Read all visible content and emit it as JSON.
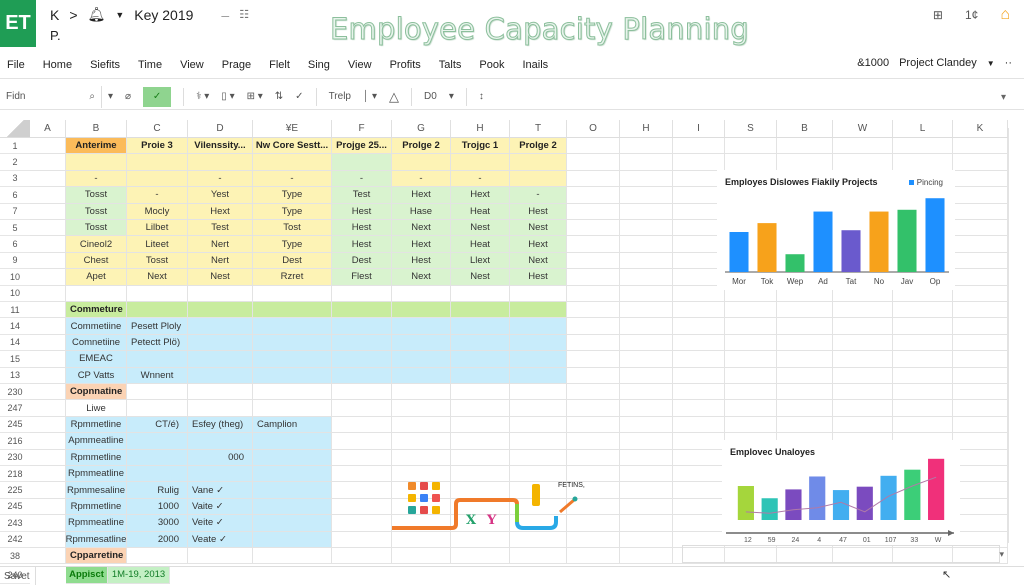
{
  "app": {
    "logo": "ET",
    "breadcrumb": [
      "K",
      ">",
      "Key 2019"
    ],
    "breadcrumb_sub": "P.",
    "doc_title": "Employee Capacity Planning",
    "top_right_icons": [
      "share-icon",
      "counter-icon",
      "home-icon"
    ],
    "top_right_counter": "1¢"
  },
  "menu": {
    "items": [
      "File",
      "Home",
      "Siefits",
      "Time",
      "View",
      "Prage",
      "Flelt",
      "Sing",
      "View",
      "Profits",
      "Talts",
      "Pook",
      "Inails"
    ],
    "user_count": "&1000",
    "project": "Project Clandey",
    "more": "··"
  },
  "toolbar": {
    "namebox": "Fidn",
    "font_name": "Trelp",
    "font_size": "D0"
  },
  "sheet": {
    "columns": [
      "A",
      "B",
      "C",
      "D",
      "¥E",
      "F",
      "G",
      "H",
      "T",
      "O",
      "H",
      "I",
      "S",
      "B",
      "W",
      "L",
      "K"
    ],
    "rows": [
      {
        "n": "1",
        "cells": [
          "",
          "Anterime",
          "Proie 3",
          "Vilenssity...",
          "Nw Core Sestt...",
          "Projge 25...",
          "Prolge 2",
          "Trojgc 1",
          "Prolge 2"
        ]
      },
      {
        "n": "2",
        "cells": [
          "",
          "",
          "",
          "",
          "",
          "",
          "",
          "",
          ""
        ]
      },
      {
        "n": "3",
        "cells": [
          "",
          "-",
          "",
          "-",
          "-",
          "-",
          "-",
          "-",
          ""
        ]
      },
      {
        "n": "6",
        "cells": [
          "",
          "Tosst",
          "-",
          "Yest",
          "Type",
          "Test",
          "Hext",
          "Hext",
          "-"
        ]
      },
      {
        "n": "7",
        "cells": [
          "",
          "Tosst",
          "Mocly",
          "Hext",
          "Type",
          "Hest",
          "Hase",
          "Heat",
          "Hest"
        ]
      },
      {
        "n": "5",
        "cells": [
          "",
          "Tosst",
          "Lilbet",
          "Test",
          "Tost",
          "Hest",
          "Next",
          "Nest",
          "Nest"
        ]
      },
      {
        "n": "6",
        "cells": [
          "",
          "Cineol2",
          "Liteet",
          "Nert",
          "Type",
          "Hest",
          "Hext",
          "Heat",
          "Hext"
        ]
      },
      {
        "n": "9",
        "cells": [
          "",
          "Chest",
          "Tosst",
          "Nert",
          "Dest",
          "Dest",
          "Hest",
          "Llext",
          "Next"
        ]
      },
      {
        "n": "10",
        "cells": [
          "",
          "Apet",
          "Next",
          "Nest",
          "Rzret",
          "Flest",
          "Next",
          "Nest",
          "Hest"
        ]
      },
      {
        "n": "10",
        "cells": [
          "",
          "",
          "",
          "",
          "",
          "",
          "",
          "",
          ""
        ]
      },
      {
        "n": "11",
        "cells": [
          "",
          "Commeture",
          "",
          "",
          "",
          "",
          "",
          "",
          ""
        ]
      },
      {
        "n": "14",
        "cells": [
          "",
          "Commetiine",
          "Pesett Ploly",
          "",
          "",
          "",
          "",
          "",
          ""
        ]
      },
      {
        "n": "14",
        "cells": [
          "",
          "Comnetiine",
          "Petectt Plö)",
          "",
          "",
          "",
          "",
          "",
          ""
        ]
      },
      {
        "n": "15",
        "cells": [
          "",
          "EMEAC",
          "",
          "",
          "",
          "",
          "",
          "",
          ""
        ]
      },
      {
        "n": "13",
        "cells": [
          "",
          "CP Vatts",
          "Wnnent",
          "",
          "",
          "",
          "",
          "",
          ""
        ]
      },
      {
        "n": "230",
        "cells": [
          "",
          "Copnnatine",
          "",
          "",
          "",
          "",
          "",
          "",
          ""
        ]
      },
      {
        "n": "247",
        "cells": [
          "",
          "Liwe",
          "",
          "",
          "",
          "",
          "",
          "",
          ""
        ]
      },
      {
        "n": "245",
        "cells": [
          "",
          "Rpmmetline",
          "CT/é)",
          "Esfey (theg)",
          "Camplion",
          "",
          "",
          "",
          ""
        ]
      },
      {
        "n": "216",
        "cells": [
          "",
          "Apmmeatline",
          "",
          "",
          "",
          "",
          "",
          "",
          ""
        ]
      },
      {
        "n": "230",
        "cells": [
          "",
          "Rpmmetline",
          "",
          "000",
          "",
          "",
          "",
          "",
          ""
        ]
      },
      {
        "n": "218",
        "cells": [
          "",
          "Rpmmeatline",
          "",
          "",
          "",
          "",
          "",
          "",
          ""
        ]
      },
      {
        "n": "225",
        "cells": [
          "",
          "Rpmmesaline",
          "Rulig",
          "Vane ✓",
          "",
          "",
          "",
          "",
          ""
        ]
      },
      {
        "n": "245",
        "cells": [
          "",
          "Rpmmetline",
          "1000",
          "Vaite ✓",
          "",
          "",
          "",
          "",
          ""
        ]
      },
      {
        "n": "243",
        "cells": [
          "",
          "Rpmmeatline",
          "3000",
          "Veite ✓",
          "",
          "",
          "",
          "",
          ""
        ]
      },
      {
        "n": "242",
        "cells": [
          "",
          "Rpmmesatline",
          "2000",
          "Veate ✓",
          "",
          "",
          "",
          "",
          ""
        ]
      },
      {
        "n": "38",
        "cells": [
          "",
          "Cpparretine",
          "",
          "",
          "",
          "",
          "",
          "",
          ""
        ]
      }
    ],
    "footer_row": {
      "n": "240",
      "label": "Appisct",
      "date": "1M-19, 2013"
    }
  },
  "illustration": {
    "label": "FETINS,",
    "glyphs": "X Y"
  },
  "status": {
    "label": "Savet"
  },
  "chart_data": [
    {
      "type": "bar",
      "title": "Employes Dislowes Fiakily Projects",
      "legend": [
        "Pincing"
      ],
      "legend_position": "top-right",
      "categories": [
        "Mor",
        "Tok",
        "Wep",
        "Ad",
        "Tat",
        "No",
        "Jav",
        "Op"
      ],
      "values": [
        4.5,
        5.5,
        2.0,
        6.8,
        4.7,
        6.8,
        7.0,
        8.3
      ],
      "colors": [
        "#1e90ff",
        "#f7a21b",
        "#33c16a",
        "#1e90ff",
        "#6a5acd",
        "#f7a21b",
        "#33c16a",
        "#1e90ff"
      ],
      "ylim": [
        0,
        9
      ],
      "grid": false
    },
    {
      "type": "bar",
      "title": "Emplovec Unaloyes",
      "categories": [
        "12",
        "59",
        "24",
        "4",
        "47",
        "01",
        "107",
        "33",
        "W"
      ],
      "series": [
        {
          "name": "bars",
          "values": [
            5.0,
            3.2,
            4.5,
            6.4,
            4.4,
            4.9,
            6.5,
            7.4,
            9.0
          ]
        },
        {
          "name": "trend",
          "type": "line",
          "values": [
            1.2,
            1.0,
            1.5,
            1.8,
            2.6,
            1.2,
            3.5,
            5.0,
            6.3
          ]
        }
      ],
      "colors": [
        "#a5d63c",
        "#2ec4b6",
        "#7b4bbf",
        "#6f8be8",
        "#42aef0",
        "#7b4bbf",
        "#42aef0",
        "#3cce78",
        "#f0307a"
      ],
      "ylim": [
        0,
        10
      ],
      "grid": false
    }
  ]
}
